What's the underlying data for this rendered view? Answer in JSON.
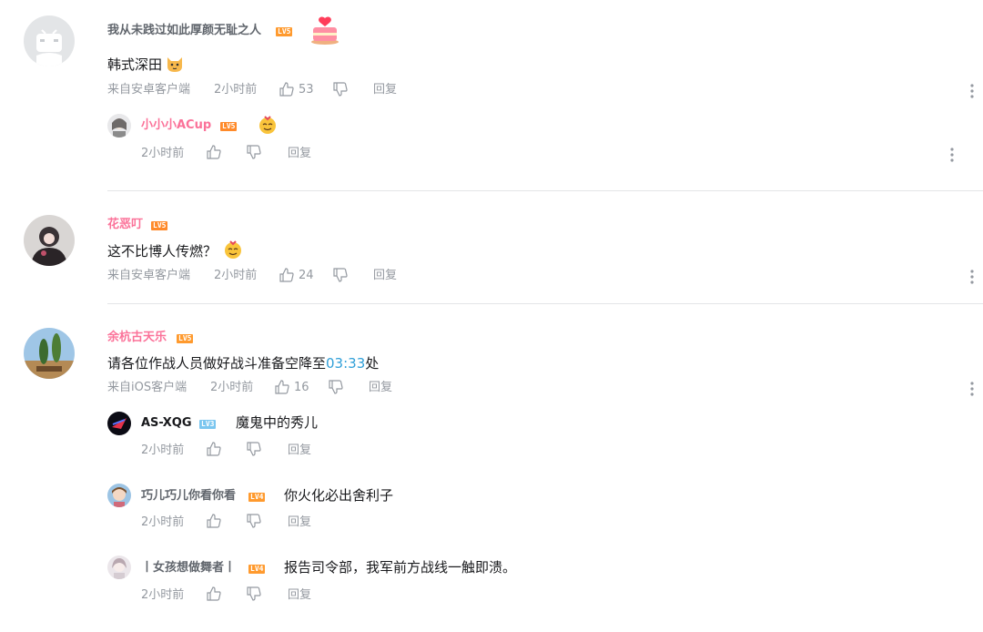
{
  "actions": {
    "reply": "回复"
  },
  "comments": [
    {
      "username": "我从未践过如此厚颜无耻之人",
      "level": "LV5",
      "text": "韩式深田",
      "source": "来自安卓客户端",
      "time": "2小时前",
      "likes": "53",
      "replies": [
        {
          "username": "小小小ACup",
          "level": "LV5",
          "time": "2小时前",
          "text": ""
        }
      ]
    },
    {
      "username": "花恶叮",
      "level": "LV5",
      "text": "这不比博人传燃？",
      "source": "来自安卓客户端",
      "time": "2小时前",
      "likes": "24"
    },
    {
      "username": "余杭古天乐",
      "level": "LV5",
      "text_prefix": "请各位作战人员做好战斗准备空降至",
      "text_link": "03:33",
      "text_suffix": "处",
      "source": "来自iOS客户端",
      "time": "2小时前",
      "likes": "16",
      "replies": [
        {
          "username": "AS-XQG",
          "level": "LV3",
          "text": "魔鬼中的秀儿",
          "time": "2小时前"
        },
        {
          "username": "巧儿巧儿你看你看",
          "level": "LV4",
          "text": "你火化必出舍利子",
          "time": "2小时前"
        },
        {
          "username": "丨女孩想做舞者丨",
          "level": "LV4",
          "text": "报告司令部，我军前方战线一触即溃。",
          "time": "2小时前"
        }
      ]
    }
  ],
  "icons": {
    "like": "thumbs-up-icon",
    "dislike": "thumbs-down-icon",
    "more": "more-dots-icon"
  }
}
